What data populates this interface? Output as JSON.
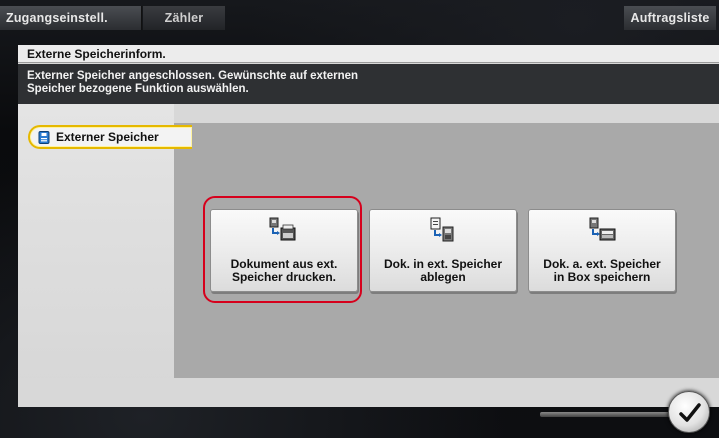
{
  "top_tabs": {
    "access_settings": "Zugangseinstell.",
    "counter": "Zähler",
    "job_list": "Auftragsliste"
  },
  "panel": {
    "title": "Externe Speicherinform.",
    "message": "Externer Speicher angeschlossen. Gewünschte auf externen\nSpeicher bezogene Funktion auswählen."
  },
  "side_tab": {
    "label": "Externer Speicher",
    "icon": "usb-memory-icon"
  },
  "functions": [
    {
      "label": "Dokument aus ext.\nSpeicher drucken.",
      "icon": "usb-to-printer-icon",
      "highlighted": true
    },
    {
      "label": "Dok. in ext. Speicher\nablegen",
      "icon": "document-to-usb-icon",
      "highlighted": false
    },
    {
      "label": "Dok. a. ext. Speicher\nin Box speichern",
      "icon": "usb-to-box-icon",
      "highlighted": false
    }
  ],
  "ok_button": {
    "icon": "checkmark-icon"
  },
  "colors": {
    "highlight_ring": "#d6001c",
    "selected_tab_border": "#e5b800",
    "message_background": "#2e3033",
    "content_background": "#a9a9a9"
  }
}
